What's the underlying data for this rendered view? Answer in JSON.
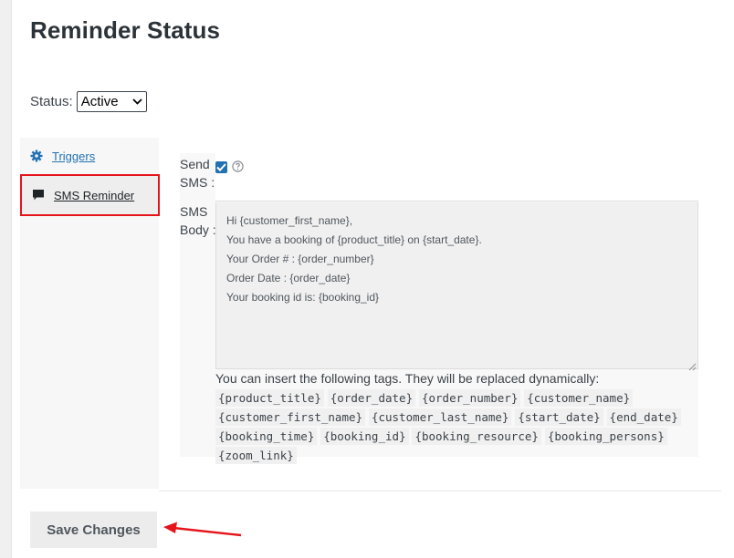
{
  "page": {
    "title": "Reminder Status"
  },
  "status": {
    "label": "Status:",
    "selected": "Active"
  },
  "tabs": [
    {
      "label": "Triggers",
      "icon": "gear-icon"
    },
    {
      "label": "SMS Reminder",
      "icon": "speech-bubble-icon"
    }
  ],
  "send_sms": {
    "label_line1": "Send",
    "label_line2": "SMS :",
    "checked": true
  },
  "sms_body": {
    "label_line1": "SMS",
    "label_line2": "Body :",
    "lines": [
      "Hi {customer_first_name},",
      "",
      "You have a booking of {product_title} on {start_date}.",
      "",
      "Your Order # : {order_number}",
      "Order Date : {order_date}",
      "Your booking id is: {booking_id}"
    ]
  },
  "help": {
    "text": "You can insert the following tags. They will be replaced dynamically:",
    "tags": [
      "{product_title}",
      "{order_date}",
      "{order_number}",
      "{customer_name}",
      "{customer_first_name}",
      "{customer_last_name}",
      "{start_date}",
      "{end_date}",
      "{booking_time}",
      "{booking_id}",
      "{booking_resource}",
      "{booking_persons}",
      "{zoom_link}"
    ]
  },
  "actions": {
    "save_label": "Save Changes"
  },
  "colors": {
    "accent": "#2271b1",
    "highlight": "#e5141b"
  }
}
